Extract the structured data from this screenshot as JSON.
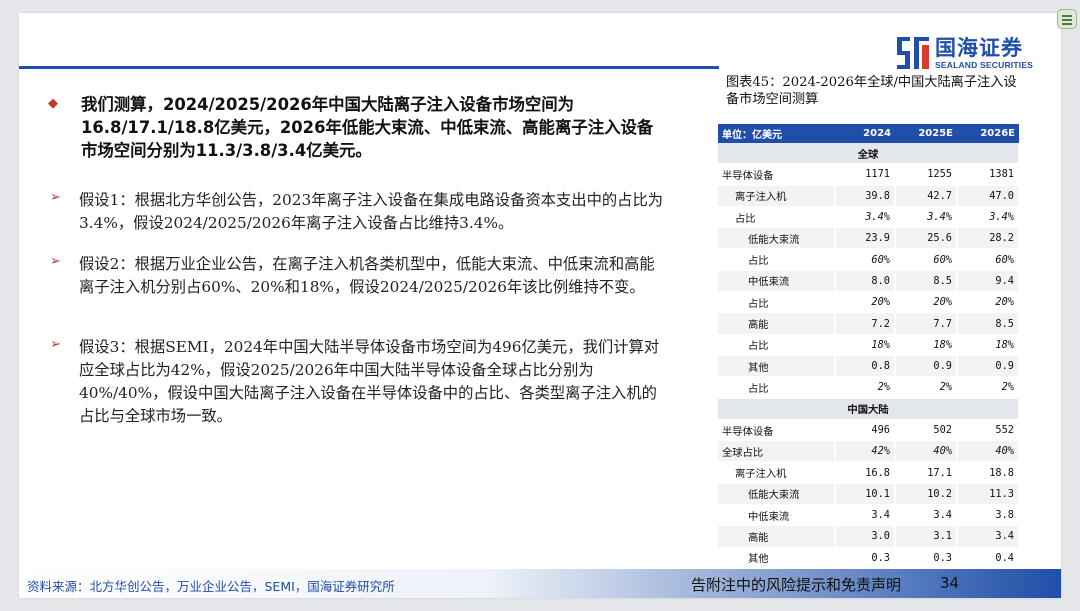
{
  "header": {
    "logo_cn": "国海证券",
    "logo_en": "SEALAND SECURITIES",
    "brand_color": "#1f4fa8"
  },
  "main": {
    "bullet_main": "我们测算，2024/2025/2026年中国大陆离子注入设备市场空间为16.8/17.1/18.8亿美元，2026年低能大束流、中低束流、高能离子注入设备市场空间分别为11.3/3.8/3.4亿美元。",
    "bullet_main_icon": "diamond-icon",
    "sub_bullet_icon": "arrow-icon",
    "sub_bullets": [
      "假设1：根据北方华创公告，2023年离子注入设备在集成电路设备资本支出中的占比为3.4%，假设2024/2025/2026年离子注入设备占比维持3.4%。",
      "假设2：根据万业企业公告，在离子注入机各类机型中，低能大束流、中低束流和高能离子注入机分别占60%、20%和18%，假设2024/2025/2026年该比例维持不变。",
      "假设3：根据SEMI，2024年中国大陆半导体设备市场空间为496亿美元，我们计算对应全球占比为42%，假设2025/2026年中国大陆半导体设备全球占比分别为40%/40%，假设中国大陆离子注入设备在半导体设备中的占比、各类型离子注入机的占比与全球市场一致。"
    ]
  },
  "table": {
    "title": "图表45：2024-2026年全球/中国大陆离子注入设备市场空间测算",
    "headers": [
      "单位：亿美元",
      "2024",
      "2025E",
      "2026E"
    ],
    "sections": [
      {
        "name": "全球",
        "rows": [
          {
            "label": "半导体设备",
            "indent": 0,
            "italic": false,
            "values": [
              "1171",
              "1255",
              "1381"
            ]
          },
          {
            "label": "离子注入机",
            "indent": 1,
            "italic": false,
            "values": [
              "39.8",
              "42.7",
              "47.0"
            ]
          },
          {
            "label": "占比",
            "indent": 1,
            "italic": true,
            "values": [
              "3.4%",
              "3.4%",
              "3.4%"
            ]
          },
          {
            "label": "低能大束流",
            "indent": 2,
            "italic": false,
            "values": [
              "23.9",
              "25.6",
              "28.2"
            ]
          },
          {
            "label": "占比",
            "indent": 2,
            "italic": true,
            "values": [
              "60%",
              "60%",
              "60%"
            ]
          },
          {
            "label": "中低束流",
            "indent": 2,
            "italic": false,
            "values": [
              "8.0",
              "8.5",
              "9.4"
            ]
          },
          {
            "label": "占比",
            "indent": 2,
            "italic": true,
            "values": [
              "20%",
              "20%",
              "20%"
            ]
          },
          {
            "label": "高能",
            "indent": 2,
            "italic": false,
            "values": [
              "7.2",
              "7.7",
              "8.5"
            ]
          },
          {
            "label": "占比",
            "indent": 2,
            "italic": true,
            "values": [
              "18%",
              "18%",
              "18%"
            ]
          },
          {
            "label": "其他",
            "indent": 2,
            "italic": false,
            "values": [
              "0.8",
              "0.9",
              "0.9"
            ]
          },
          {
            "label": "占比",
            "indent": 2,
            "italic": true,
            "values": [
              "2%",
              "2%",
              "2%"
            ]
          }
        ]
      },
      {
        "name": "中国大陆",
        "rows": [
          {
            "label": "半导体设备",
            "indent": 0,
            "italic": false,
            "values": [
              "496",
              "502",
              "552"
            ]
          },
          {
            "label": "全球占比",
            "indent": 0,
            "italic": true,
            "values": [
              "42%",
              "40%",
              "40%"
            ]
          },
          {
            "label": "离子注入机",
            "indent": 1,
            "italic": false,
            "values": [
              "16.8",
              "17.1",
              "18.8"
            ]
          },
          {
            "label": "低能大束流",
            "indent": 2,
            "italic": false,
            "values": [
              "10.1",
              "10.2",
              "11.3"
            ]
          },
          {
            "label": "中低束流",
            "indent": 2,
            "italic": false,
            "values": [
              "3.4",
              "3.4",
              "3.8"
            ]
          },
          {
            "label": "高能",
            "indent": 2,
            "italic": false,
            "values": [
              "3.0",
              "3.1",
              "3.4"
            ]
          },
          {
            "label": "其他",
            "indent": 2,
            "italic": false,
            "values": [
              "0.3",
              "0.3",
              "0.4"
            ]
          }
        ]
      }
    ]
  },
  "footer": {
    "source": "资料来源：北方华创公告，万业企业公告，SEMI，国海证券研究所",
    "disclaimer": "告附注中的风险提示和免责声明",
    "page": "34"
  }
}
